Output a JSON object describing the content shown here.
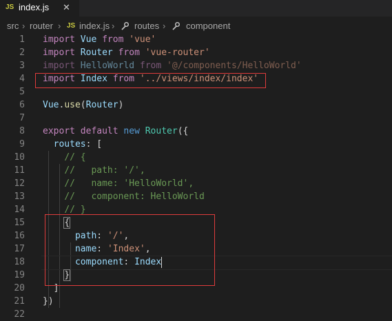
{
  "tab": {
    "icon": "JS",
    "filename": "index.js",
    "close": "✕"
  },
  "breadcrumb": {
    "items": [
      "src",
      "router",
      "index.js",
      "routes",
      "component"
    ],
    "file_icon": "JS",
    "separator": "›"
  },
  "editor": {
    "lines": [
      {
        "n": "1",
        "tokens": [
          [
            "kw2",
            "import"
          ],
          [
            "",
            " "
          ],
          [
            "var",
            "Vue"
          ],
          [
            "",
            " "
          ],
          [
            "kw2",
            "from"
          ],
          [
            "",
            " "
          ],
          [
            "str",
            "'vue'"
          ]
        ]
      },
      {
        "n": "2",
        "tokens": [
          [
            "kw2",
            "import"
          ],
          [
            "",
            " "
          ],
          [
            "var",
            "Router"
          ],
          [
            "",
            " "
          ],
          [
            "kw2",
            "from"
          ],
          [
            "",
            " "
          ],
          [
            "str",
            "'vue-router'"
          ]
        ]
      },
      {
        "n": "3",
        "dim": true,
        "tokens": [
          [
            "kw2",
            "import"
          ],
          [
            "",
            " "
          ],
          [
            "var",
            "HelloWorld"
          ],
          [
            "",
            " "
          ],
          [
            "kw2",
            "from"
          ],
          [
            "",
            " "
          ],
          [
            "str",
            "'@/components/HelloWorld'"
          ]
        ]
      },
      {
        "n": "4",
        "tokens": [
          [
            "kw2",
            "import"
          ],
          [
            "",
            " "
          ],
          [
            "var",
            "Index"
          ],
          [
            "",
            " "
          ],
          [
            "kw2",
            "from"
          ],
          [
            "",
            " "
          ],
          [
            "str",
            "'../views/index/index'"
          ]
        ]
      },
      {
        "n": "5",
        "tokens": []
      },
      {
        "n": "6",
        "tokens": [
          [
            "var",
            "Vue"
          ],
          [
            "",
            "."
          ],
          [
            "fn",
            "use"
          ],
          [
            "",
            "("
          ],
          [
            "var",
            "Router"
          ],
          [
            "",
            ")"
          ]
        ]
      },
      {
        "n": "7",
        "tokens": []
      },
      {
        "n": "8",
        "tokens": [
          [
            "kw2",
            "export"
          ],
          [
            "",
            " "
          ],
          [
            "kw2",
            "default"
          ],
          [
            "",
            " "
          ],
          [
            "kw",
            "new"
          ],
          [
            "",
            " "
          ],
          [
            "cls",
            "Router"
          ],
          [
            "",
            "({"
          ]
        ]
      },
      {
        "n": "9",
        "tokens": [
          [
            "",
            "  "
          ],
          [
            "var",
            "routes"
          ],
          [
            "",
            ": ["
          ]
        ]
      },
      {
        "n": "10",
        "tokens": [
          [
            "",
            "    "
          ],
          [
            "cm",
            "// {"
          ]
        ]
      },
      {
        "n": "11",
        "tokens": [
          [
            "",
            "    "
          ],
          [
            "cm",
            "//   path: '/',"
          ]
        ]
      },
      {
        "n": "12",
        "tokens": [
          [
            "",
            "    "
          ],
          [
            "cm",
            "//   name: 'HelloWorld',"
          ]
        ]
      },
      {
        "n": "13",
        "tokens": [
          [
            "",
            "    "
          ],
          [
            "cm",
            "//   component: HelloWorld"
          ]
        ]
      },
      {
        "n": "14",
        "tokens": [
          [
            "",
            "    "
          ],
          [
            "cm",
            "// }"
          ]
        ]
      },
      {
        "n": "15",
        "tokens": [
          [
            "",
            "    "
          ],
          [
            "bracket",
            "{"
          ]
        ]
      },
      {
        "n": "16",
        "tokens": [
          [
            "",
            "      "
          ],
          [
            "var",
            "path"
          ],
          [
            "",
            ": "
          ],
          [
            "str",
            "'/'"
          ],
          [
            "",
            ","
          ]
        ]
      },
      {
        "n": "17",
        "tokens": [
          [
            "",
            "      "
          ],
          [
            "var",
            "name"
          ],
          [
            "",
            ": "
          ],
          [
            "str",
            "'Index'"
          ],
          [
            "",
            ","
          ]
        ]
      },
      {
        "n": "18",
        "tokens": [
          [
            "",
            "      "
          ],
          [
            "var",
            "component"
          ],
          [
            "",
            ": "
          ],
          [
            "var",
            "Index"
          ],
          [
            "cursor",
            ""
          ]
        ]
      },
      {
        "n": "19",
        "tokens": [
          [
            "",
            "    "
          ],
          [
            "bracket",
            "}"
          ]
        ]
      },
      {
        "n": "20",
        "tokens": [
          [
            "",
            "  "
          ],
          [
            "",
            "]"
          ]
        ]
      },
      {
        "n": "21",
        "tokens": [
          [
            "",
            "})"
          ]
        ]
      },
      {
        "n": "22",
        "tokens": []
      }
    ]
  }
}
